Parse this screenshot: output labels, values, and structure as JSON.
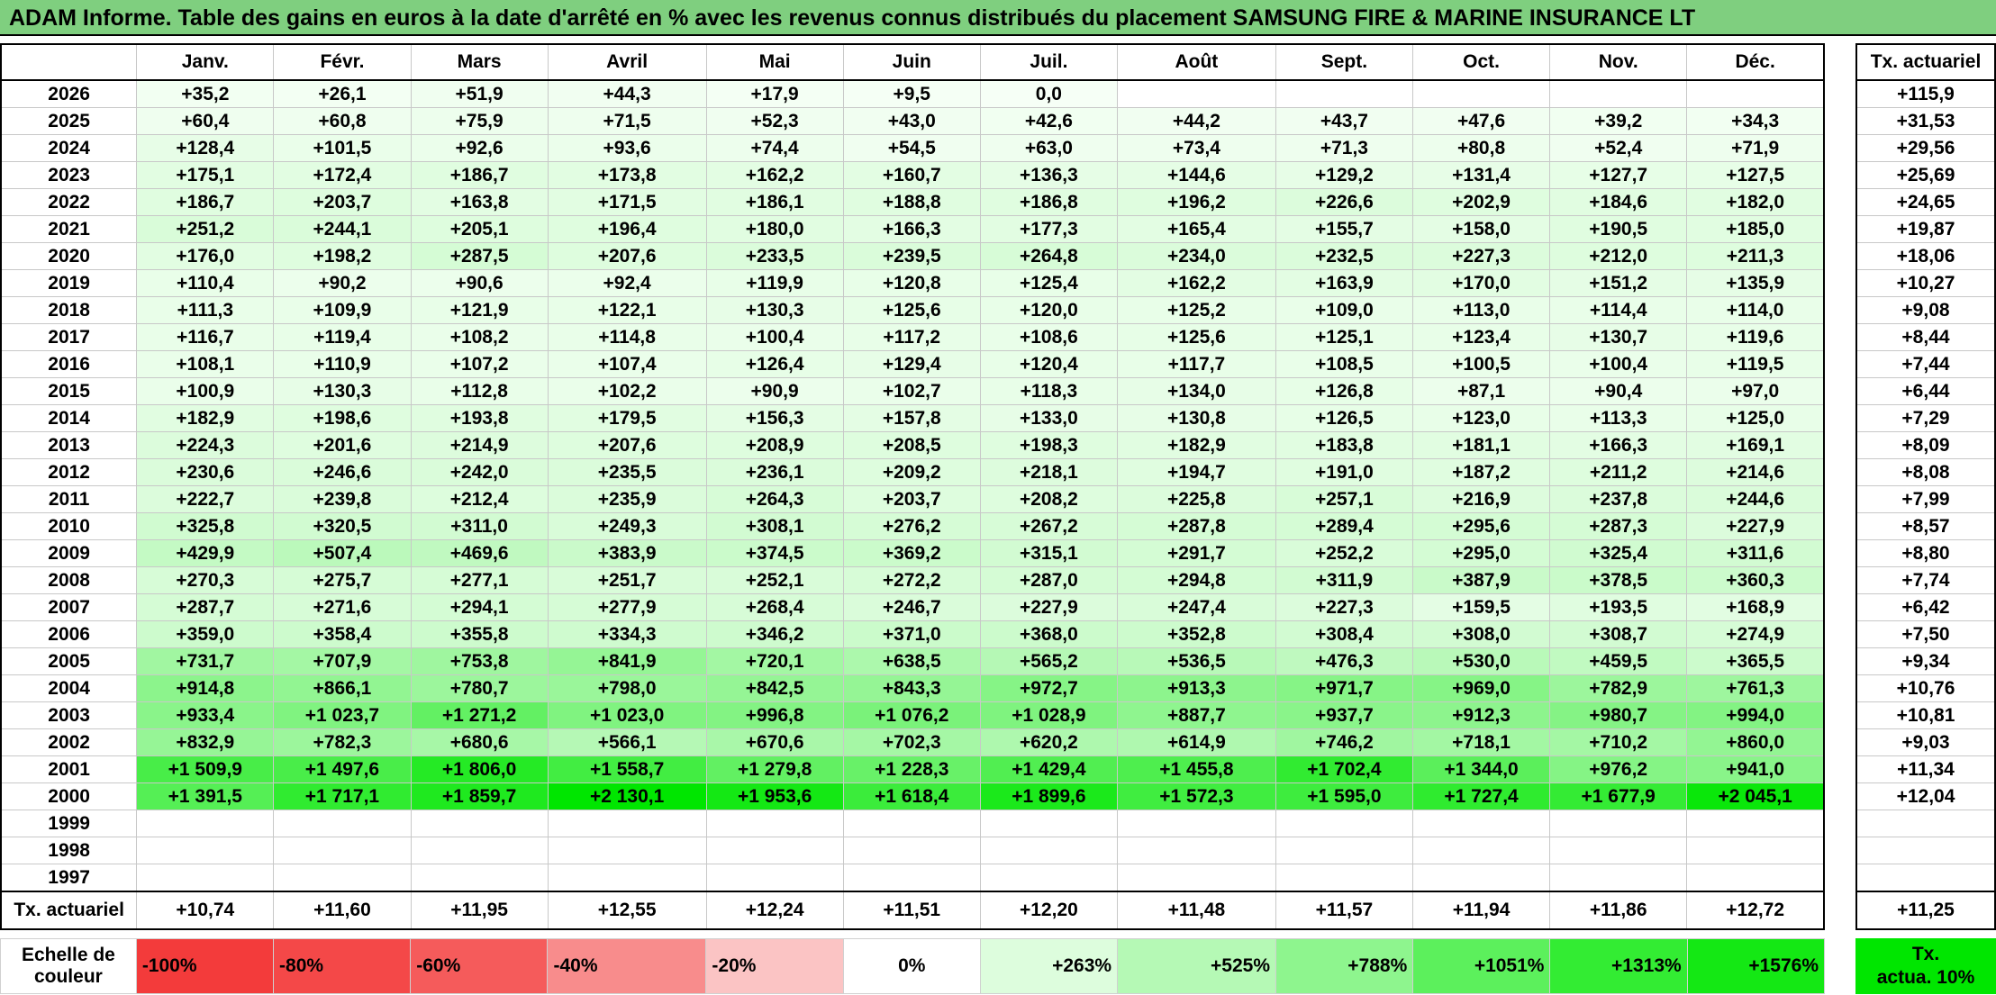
{
  "title": "ADAM Informe. Table des gains en euros à la date d'arrêté en % avec les revenus connus distribués du placement SAMSUNG FIRE & MARINE INSURANCE LT",
  "months": [
    "Janv.",
    "Févr.",
    "Mars",
    "Avril",
    "Mai",
    "Juin",
    "Juil.",
    "Août",
    "Sept.",
    "Oct.",
    "Nov.",
    "Déc."
  ],
  "side_header": "Tx. actuariel",
  "rows": [
    {
      "year": "2026",
      "cells": [
        "+35,2",
        "+26,1",
        "+51,9",
        "+44,3",
        "+17,9",
        "+9,5",
        "0,0",
        "",
        "",
        "",
        "",
        ""
      ],
      "rate": "+115,9"
    },
    {
      "year": "2025",
      "cells": [
        "+60,4",
        "+60,8",
        "+75,9",
        "+71,5",
        "+52,3",
        "+43,0",
        "+42,6",
        "+44,2",
        "+43,7",
        "+47,6",
        "+39,2",
        "+34,3"
      ],
      "rate": "+31,53"
    },
    {
      "year": "2024",
      "cells": [
        "+128,4",
        "+101,5",
        "+92,6",
        "+93,6",
        "+74,4",
        "+54,5",
        "+63,0",
        "+73,4",
        "+71,3",
        "+80,8",
        "+52,4",
        "+71,9"
      ],
      "rate": "+29,56"
    },
    {
      "year": "2023",
      "cells": [
        "+175,1",
        "+172,4",
        "+186,7",
        "+173,8",
        "+162,2",
        "+160,7",
        "+136,3",
        "+144,6",
        "+129,2",
        "+131,4",
        "+127,7",
        "+127,5"
      ],
      "rate": "+25,69"
    },
    {
      "year": "2022",
      "cells": [
        "+186,7",
        "+203,7",
        "+163,8",
        "+171,5",
        "+186,1",
        "+188,8",
        "+186,8",
        "+196,2",
        "+226,6",
        "+202,9",
        "+184,6",
        "+182,0"
      ],
      "rate": "+24,65"
    },
    {
      "year": "2021",
      "cells": [
        "+251,2",
        "+244,1",
        "+205,1",
        "+196,4",
        "+180,0",
        "+166,3",
        "+177,3",
        "+165,4",
        "+155,7",
        "+158,0",
        "+190,5",
        "+185,0"
      ],
      "rate": "+19,87"
    },
    {
      "year": "2020",
      "cells": [
        "+176,0",
        "+198,2",
        "+287,5",
        "+207,6",
        "+233,5",
        "+239,5",
        "+264,8",
        "+234,0",
        "+232,5",
        "+227,3",
        "+212,0",
        "+211,3"
      ],
      "rate": "+18,06"
    },
    {
      "year": "2019",
      "cells": [
        "+110,4",
        "+90,2",
        "+90,6",
        "+92,4",
        "+119,9",
        "+120,8",
        "+125,4",
        "+162,2",
        "+163,9",
        "+170,0",
        "+151,2",
        "+135,9"
      ],
      "rate": "+10,27"
    },
    {
      "year": "2018",
      "cells": [
        "+111,3",
        "+109,9",
        "+121,9",
        "+122,1",
        "+130,3",
        "+125,6",
        "+120,0",
        "+125,2",
        "+109,0",
        "+113,0",
        "+114,4",
        "+114,0"
      ],
      "rate": "+9,08"
    },
    {
      "year": "2017",
      "cells": [
        "+116,7",
        "+119,4",
        "+108,2",
        "+114,8",
        "+100,4",
        "+117,2",
        "+108,6",
        "+125,6",
        "+125,1",
        "+123,4",
        "+130,7",
        "+119,6"
      ],
      "rate": "+8,44"
    },
    {
      "year": "2016",
      "cells": [
        "+108,1",
        "+110,9",
        "+107,2",
        "+107,4",
        "+126,4",
        "+129,4",
        "+120,4",
        "+117,7",
        "+108,5",
        "+100,5",
        "+100,4",
        "+119,5"
      ],
      "rate": "+7,44"
    },
    {
      "year": "2015",
      "cells": [
        "+100,9",
        "+130,3",
        "+112,8",
        "+102,2",
        "+90,9",
        "+102,7",
        "+118,3",
        "+134,0",
        "+126,8",
        "+87,1",
        "+90,4",
        "+97,0"
      ],
      "rate": "+6,44"
    },
    {
      "year": "2014",
      "cells": [
        "+182,9",
        "+198,6",
        "+193,8",
        "+179,5",
        "+156,3",
        "+157,8",
        "+133,0",
        "+130,8",
        "+126,5",
        "+123,0",
        "+113,3",
        "+125,0"
      ],
      "rate": "+7,29"
    },
    {
      "year": "2013",
      "cells": [
        "+224,3",
        "+201,6",
        "+214,9",
        "+207,6",
        "+208,9",
        "+208,5",
        "+198,3",
        "+182,9",
        "+183,8",
        "+181,1",
        "+166,3",
        "+169,1"
      ],
      "rate": "+8,09"
    },
    {
      "year": "2012",
      "cells": [
        "+230,6",
        "+246,6",
        "+242,0",
        "+235,5",
        "+236,1",
        "+209,2",
        "+218,1",
        "+194,7",
        "+191,0",
        "+187,2",
        "+211,2",
        "+214,6"
      ],
      "rate": "+8,08"
    },
    {
      "year": "2011",
      "cells": [
        "+222,7",
        "+239,8",
        "+212,4",
        "+235,9",
        "+264,3",
        "+203,7",
        "+208,2",
        "+225,8",
        "+257,1",
        "+216,9",
        "+237,8",
        "+244,6"
      ],
      "rate": "+7,99"
    },
    {
      "year": "2010",
      "cells": [
        "+325,8",
        "+320,5",
        "+311,0",
        "+249,3",
        "+308,1",
        "+276,2",
        "+267,2",
        "+287,8",
        "+289,4",
        "+295,6",
        "+287,3",
        "+227,9"
      ],
      "rate": "+8,57"
    },
    {
      "year": "2009",
      "cells": [
        "+429,9",
        "+507,4",
        "+469,6",
        "+383,9",
        "+374,5",
        "+369,2",
        "+315,1",
        "+291,7",
        "+252,2",
        "+295,0",
        "+325,4",
        "+311,6"
      ],
      "rate": "+8,80"
    },
    {
      "year": "2008",
      "cells": [
        "+270,3",
        "+275,7",
        "+277,1",
        "+251,7",
        "+252,1",
        "+272,2",
        "+287,0",
        "+294,8",
        "+311,9",
        "+387,9",
        "+378,5",
        "+360,3"
      ],
      "rate": "+7,74"
    },
    {
      "year": "2007",
      "cells": [
        "+287,7",
        "+271,6",
        "+294,1",
        "+277,9",
        "+268,4",
        "+246,7",
        "+227,9",
        "+247,4",
        "+227,3",
        "+159,5",
        "+193,5",
        "+168,9"
      ],
      "rate": "+6,42"
    },
    {
      "year": "2006",
      "cells": [
        "+359,0",
        "+358,4",
        "+355,8",
        "+334,3",
        "+346,2",
        "+371,0",
        "+368,0",
        "+352,8",
        "+308,4",
        "+308,0",
        "+308,7",
        "+274,9"
      ],
      "rate": "+7,50"
    },
    {
      "year": "2005",
      "cells": [
        "+731,7",
        "+707,9",
        "+753,8",
        "+841,9",
        "+720,1",
        "+638,5",
        "+565,2",
        "+536,5",
        "+476,3",
        "+530,0",
        "+459,5",
        "+365,5"
      ],
      "rate": "+9,34"
    },
    {
      "year": "2004",
      "cells": [
        "+914,8",
        "+866,1",
        "+780,7",
        "+798,0",
        "+842,5",
        "+843,3",
        "+972,7",
        "+913,3",
        "+971,7",
        "+969,0",
        "+782,9",
        "+761,3"
      ],
      "rate": "+10,76"
    },
    {
      "year": "2003",
      "cells": [
        "+933,4",
        "+1 023,7",
        "+1 271,2",
        "+1 023,0",
        "+996,8",
        "+1 076,2",
        "+1 028,9",
        "+887,7",
        "+937,7",
        "+912,3",
        "+980,7",
        "+994,0"
      ],
      "rate": "+10,81"
    },
    {
      "year": "2002",
      "cells": [
        "+832,9",
        "+782,3",
        "+680,6",
        "+566,1",
        "+670,6",
        "+702,3",
        "+620,2",
        "+614,9",
        "+746,2",
        "+718,1",
        "+710,2",
        "+860,0"
      ],
      "rate": "+9,03"
    },
    {
      "year": "2001",
      "cells": [
        "+1 509,9",
        "+1 497,6",
        "+1 806,0",
        "+1 558,7",
        "+1 279,8",
        "+1 228,3",
        "+1 429,4",
        "+1 455,8",
        "+1 702,4",
        "+1 344,0",
        "+976,2",
        "+941,0"
      ],
      "rate": "+11,34"
    },
    {
      "year": "2000",
      "cells": [
        "+1 391,5",
        "+1 717,1",
        "+1 859,7",
        "+2 130,1",
        "+1 953,6",
        "+1 618,4",
        "+1 899,6",
        "+1 572,3",
        "+1 595,0",
        "+1 727,4",
        "+1 677,9",
        "+2 045,1"
      ],
      "rate": "+12,04"
    },
    {
      "year": "1999",
      "cells": [
        "",
        "",
        "",
        "",
        "",
        "",
        "",
        "",
        "",
        "",
        "",
        ""
      ],
      "rate": ""
    },
    {
      "year": "1998",
      "cells": [
        "",
        "",
        "",
        "",
        "",
        "",
        "",
        "",
        "",
        "",
        "",
        ""
      ],
      "rate": ""
    },
    {
      "year": "1997",
      "cells": [
        "",
        "",
        "",
        "",
        "",
        "",
        "",
        "",
        "",
        "",
        "",
        ""
      ],
      "rate": ""
    }
  ],
  "avg_row": {
    "label": "Tx. actuariel",
    "cells": [
      "+10,74",
      "+11,60",
      "+11,95",
      "+12,55",
      "+12,24",
      "+11,51",
      "+12,20",
      "+11,48",
      "+11,57",
      "+11,94",
      "+11,86",
      "+12,72"
    ],
    "rate": "+11,25"
  },
  "legend": {
    "label_line1": "Echelle de",
    "label_line2": "couleur",
    "steps": [
      {
        "label": "-100%",
        "color": "#f33b3b",
        "kind": "neg"
      },
      {
        "label": "-80%",
        "color": "#f44848",
        "kind": "neg"
      },
      {
        "label": "-60%",
        "color": "#f55b5b",
        "kind": "neg"
      },
      {
        "label": "-40%",
        "color": "#f88c8c",
        "kind": "neg"
      },
      {
        "label": "-20%",
        "color": "#fbc4c4",
        "kind": "neg"
      },
      {
        "label": "0%",
        "color": "#ffffff",
        "kind": "zero"
      },
      {
        "label": "+263%",
        "color": "#ddfddd",
        "kind": "pos"
      },
      {
        "label": "+525%",
        "color": "#b5f9b5",
        "kind": "pos"
      },
      {
        "label": "+788%",
        "color": "#8ef58e",
        "kind": "pos"
      },
      {
        "label": "+1051%",
        "color": "#5cf05c",
        "kind": "pos"
      },
      {
        "label": "+1313%",
        "color": "#33ec33",
        "kind": "pos"
      },
      {
        "label": "+1576%",
        "color": "#14e814",
        "kind": "pos"
      }
    ],
    "side_line1": "Tx.",
    "side_line2": "actua. 10%"
  },
  "colors": {
    "title_bg": "#7fcf7f",
    "max_green": "#00e600"
  }
}
